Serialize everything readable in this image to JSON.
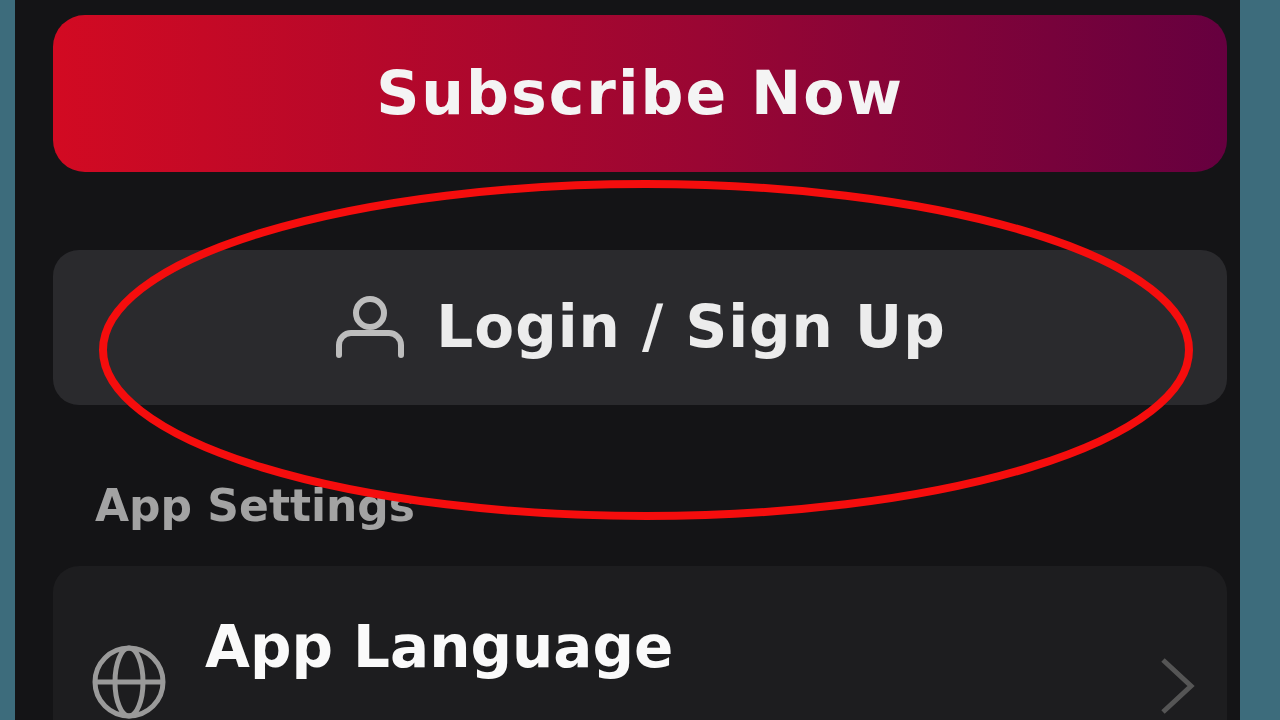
{
  "subscribe_button": {
    "label": "Subscribe Now"
  },
  "login_button": {
    "label": "Login / Sign Up",
    "highlighted": true
  },
  "section_title": "App Settings",
  "settings_items": [
    {
      "label": "App Language"
    }
  ]
}
